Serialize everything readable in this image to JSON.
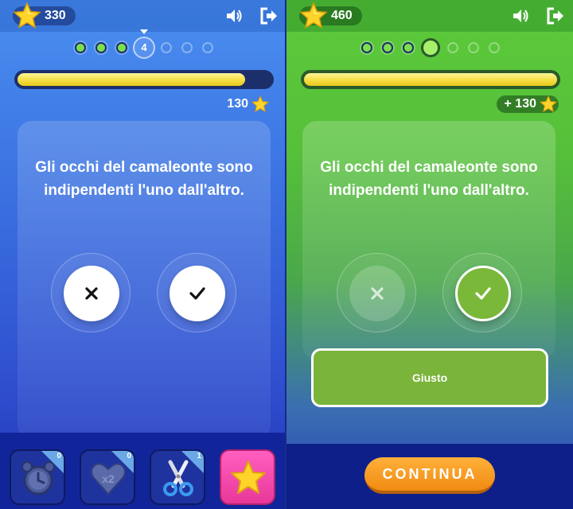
{
  "colors": {
    "left_bg": "#3a6fe0",
    "right_bg": "#56c03a",
    "progress_fill": "#f6e04a",
    "correct_green": "#7ab43a",
    "continue_orange": "#f39a20",
    "powerup_star": "#e8389a"
  },
  "left": {
    "score": "330",
    "current_question": "4",
    "progress_fraction": 0.9,
    "reward": "130",
    "question": "Gli occhi del camaleonte sono indipendenti l'uno dall'altro.",
    "answers": [
      {
        "icon": "close-icon"
      },
      {
        "icon": "check-icon"
      }
    ],
    "powerups": [
      {
        "icon": "alarm-clock-icon",
        "count": "0"
      },
      {
        "icon": "heart-x2-icon",
        "count": "0",
        "text": "x2"
      },
      {
        "icon": "scissors-icon",
        "count": "1"
      },
      {
        "icon": "star-icon"
      }
    ]
  },
  "right": {
    "score": "460",
    "progress_fraction": 1.0,
    "reward": "+ 130",
    "question": "Gli occhi del camaleonte sono indipendenti l'uno dall'altro.",
    "result": "Giusto",
    "continue_label": "CONTINUA"
  }
}
